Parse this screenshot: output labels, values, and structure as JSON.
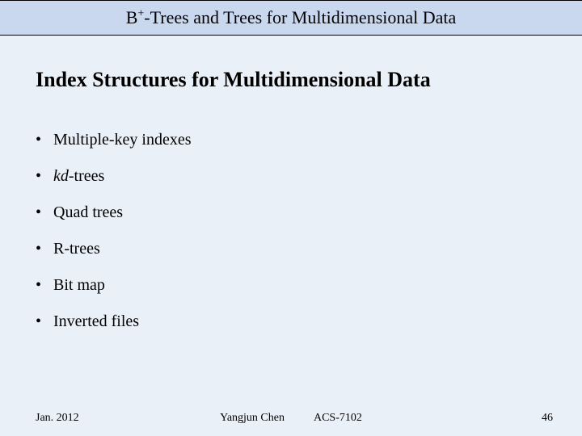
{
  "header": {
    "title_prefix": "B",
    "title_sup": "+",
    "title_rest": "-Trees and Trees for Multidimensional Data"
  },
  "body": {
    "section_heading": "Index Structures for Multidimensional Data",
    "items": [
      {
        "label": "Multiple-key indexes",
        "italic_prefix": ""
      },
      {
        "label": "-trees",
        "italic_prefix": "kd"
      },
      {
        "label": "Quad trees",
        "italic_prefix": ""
      },
      {
        "label": "R-trees",
        "italic_prefix": ""
      },
      {
        "label": "Bit map",
        "italic_prefix": ""
      },
      {
        "label": "Inverted files",
        "italic_prefix": ""
      }
    ]
  },
  "footer": {
    "date": "Jan. 2012",
    "author": "Yangjun Chen",
    "course": "ACS-7102",
    "page": "46"
  }
}
